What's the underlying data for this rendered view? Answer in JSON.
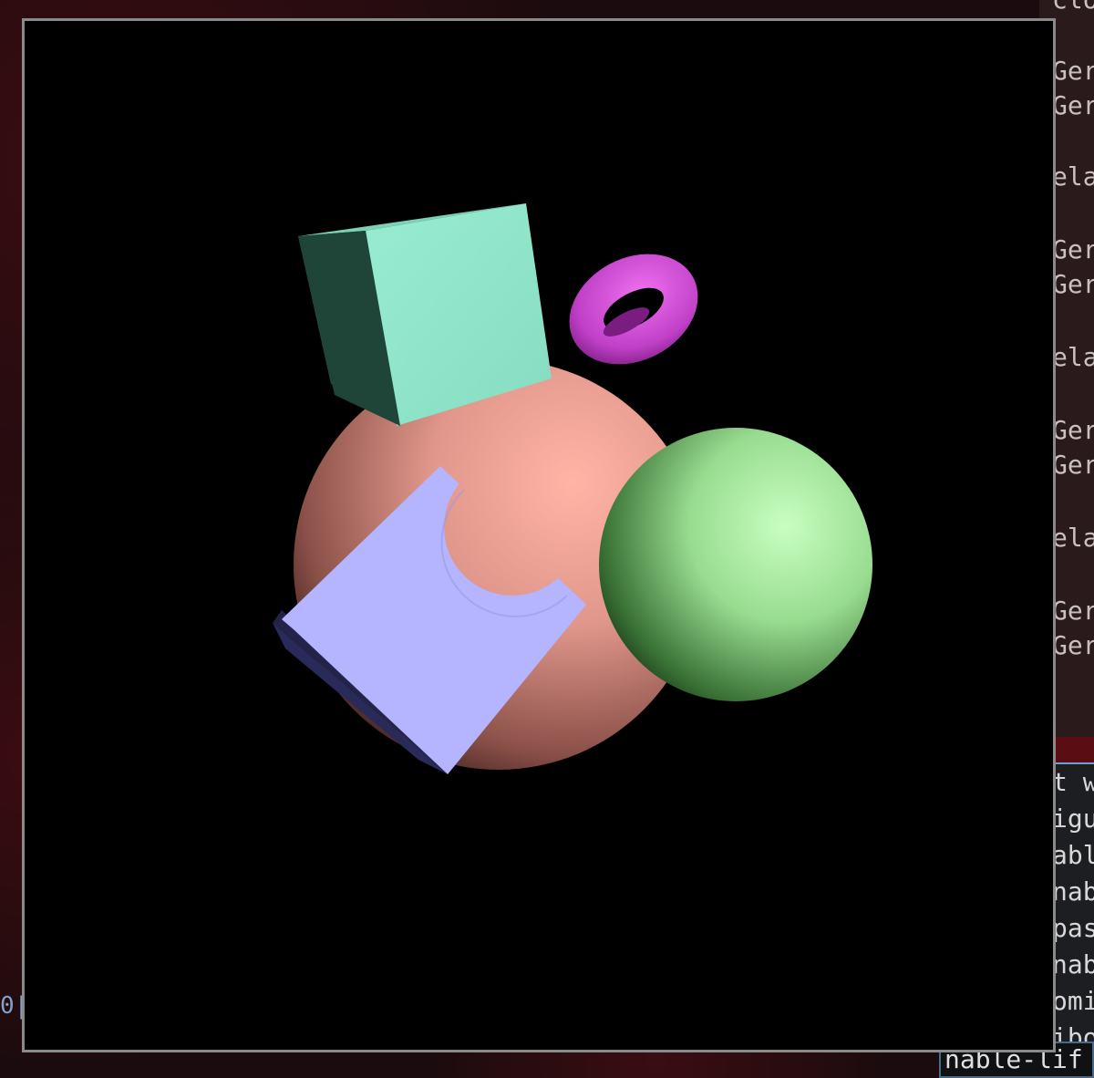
{
  "scene": {
    "background_color": "#000000",
    "objects": [
      {
        "name": "cube",
        "color": "#8fe6c8"
      },
      {
        "name": "torus",
        "color": "#e055e6"
      },
      {
        "name": "sphere",
        "color": "#e89a8e"
      },
      {
        "name": "sphere",
        "color": "#a8f0a0"
      },
      {
        "name": "cube",
        "color": "#b4b4ff"
      }
    ]
  },
  "terminal": {
    "right_lines": [
      "Ger",
      "Ger",
      "ela",
      "Ger",
      "Ger",
      "ela",
      "Ger",
      "Ger",
      "ela",
      "Ger",
      "Ger"
    ],
    "top_partial": "clo",
    "bottom_lines": [
      "t w",
      "igu",
      "abl",
      "nab",
      "pas",
      "nab",
      "omi",
      "ibo"
    ],
    "prompt_text": "nable-lif",
    "left_glyph": "0|"
  }
}
